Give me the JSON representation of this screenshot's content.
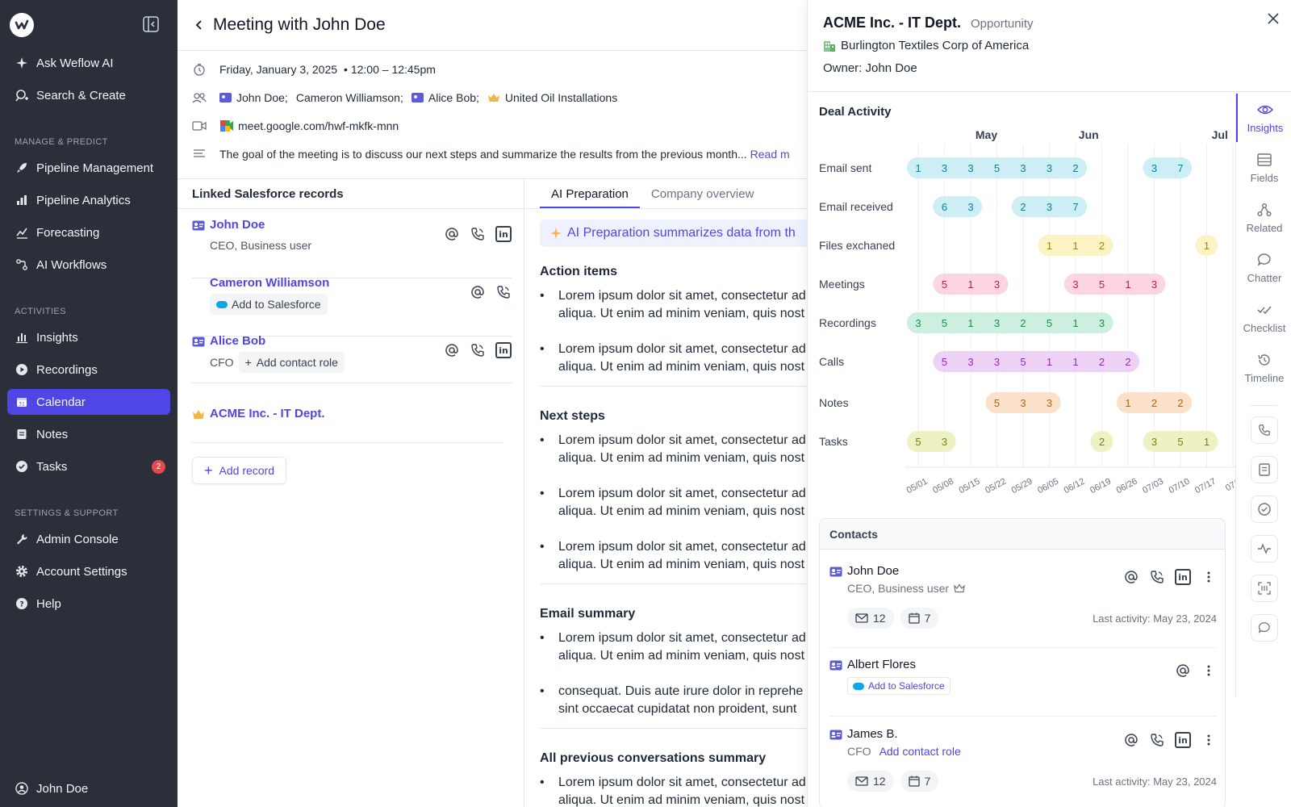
{
  "sidebar": {
    "top": [
      {
        "label": "Ask Weflow AI",
        "icon": "sparkle-icon"
      },
      {
        "label": "Search & Create",
        "icon": "search-plus-icon"
      }
    ],
    "sections": [
      {
        "title": "MANAGE & PREDICT",
        "items": [
          {
            "label": "Pipeline Management",
            "icon": "rocket-icon"
          },
          {
            "label": "Pipeline Analytics",
            "icon": "bar-chart-icon"
          },
          {
            "label": "Forecasting",
            "icon": "forecast-icon"
          },
          {
            "label": "AI Workflows",
            "icon": "workflow-icon"
          }
        ]
      },
      {
        "title": "ACTIVITIES",
        "items": [
          {
            "label": "Insights",
            "icon": "insights-icon"
          },
          {
            "label": "Recordings",
            "icon": "play-icon"
          },
          {
            "label": "Calendar",
            "icon": "calendar-icon"
          },
          {
            "label": "Notes",
            "icon": "note-icon"
          },
          {
            "label": "Tasks",
            "icon": "check-circle-icon",
            "badge": "2"
          }
        ]
      },
      {
        "title": "SETTINGS & SUPPORT",
        "items": [
          {
            "label": "Admin Console",
            "icon": "wrench-icon"
          },
          {
            "label": "Account Settings",
            "icon": "gear-icon"
          },
          {
            "label": "Help",
            "icon": "help-icon"
          }
        ]
      }
    ],
    "active": "Calendar",
    "user": "John Doe"
  },
  "meeting": {
    "title": "Meeting with John Doe",
    "date": "Friday, January 3, 2025",
    "time": "• 12:00 – 12:45pm",
    "attendees": [
      "John Doe;",
      "Cameron Williamson;",
      "Alice Bob;",
      "United Oil Installations"
    ],
    "meet_link": "meet.google.com/hwf-mkfk-mnn",
    "description": "The goal of the meeting is to discuss our next steps and summarize the results from the previous month...",
    "read_more": "Read m"
  },
  "linked": {
    "title": "Linked Salesforce records",
    "records": [
      {
        "name": "John Doe",
        "sub": "CEO, Business user"
      },
      {
        "name": "Cameron Williamson",
        "add_label": "Add to Salesforce"
      },
      {
        "name": "Alice Bob",
        "role": "CFO",
        "add_role": "Add contact role"
      },
      {
        "name": "ACME Inc. - IT Dept."
      }
    ],
    "add_record": "Add record"
  },
  "ai_panel": {
    "tabs": [
      "AI Preparation",
      "Company overview"
    ],
    "banner": "AI Preparation summarizes data from th",
    "sections": [
      {
        "title": "Action items",
        "bullets": [
          [
            "Lorem ipsum dolor sit amet, consectetur ad",
            "aliqua. Ut enim ad minim veniam, quis nost"
          ],
          [
            "Lorem ipsum dolor sit amet, consectetur ad",
            "aliqua. Ut enim ad minim veniam, quis nost"
          ]
        ]
      },
      {
        "title": "Next steps",
        "bullets": [
          [
            "Lorem ipsum dolor sit amet, consectetur ad",
            "aliqua. Ut enim ad minim veniam, quis nost"
          ],
          [
            "Lorem ipsum dolor sit amet, consectetur ad",
            "aliqua. Ut enim ad minim veniam, quis nost"
          ],
          [
            "Lorem ipsum dolor sit amet, consectetur ad",
            "aliqua. Ut enim ad minim veniam, quis nost"
          ]
        ]
      },
      {
        "title": "Email summary",
        "bullets": [
          [
            "Lorem ipsum dolor sit amet, consectetur ad",
            "aliqua. Ut enim ad minim veniam, quis nost"
          ],
          [
            "consequat. Duis aute irure dolor in reprehe",
            "sint occaecat cupidatat non proident, sunt"
          ]
        ]
      },
      {
        "title": "All previous conversations summary",
        "bullets": [
          [
            "Lorem ipsum dolor sit amet, consectetur ad",
            "aliqua. Ut enim ad minim veniam, quis nost"
          ]
        ]
      }
    ]
  },
  "panel": {
    "title": "ACME Inc. - IT Dept.",
    "kind": "Opportunity",
    "company": "Burlington Textiles Corp of America",
    "owner": "Owner: John Doe",
    "activity_title": "Deal Activity",
    "rail": [
      "Insights",
      "Fields",
      "Related",
      "Chatter",
      "Checklist",
      "Timeline"
    ]
  },
  "chart_data": {
    "type": "timeline-bubbles",
    "title": "Deal Activity",
    "months": [
      "May",
      "Jun",
      "Jul"
    ],
    "weeks": [
      "05/01",
      "05/08",
      "05/15",
      "05/22",
      "05/29",
      "06/05",
      "06/12",
      "06/19",
      "06/26",
      "07/03",
      "07/10",
      "07/17",
      "07/"
    ],
    "series": [
      {
        "name": "Email sent",
        "color": "#cdeef4",
        "text": "#0e7f96",
        "groups": [
          {
            "start": 0,
            "values": [
              1,
              3,
              3,
              5,
              3,
              3,
              2
            ]
          },
          {
            "start": 9,
            "values": [
              3,
              7
            ]
          }
        ]
      },
      {
        "name": "Email received",
        "color": "#cdeef4",
        "text": "#0e7f96",
        "groups": [
          {
            "start": 1,
            "values": [
              6,
              3
            ]
          },
          {
            "start": 4,
            "values": [
              2,
              3,
              7
            ]
          }
        ]
      },
      {
        "name": "Files exchaned",
        "color": "#fbf3c4",
        "text": "#a08310",
        "groups": [
          {
            "start": 5,
            "values": [
              1,
              1,
              2
            ]
          },
          {
            "start": 11,
            "values": [
              1
            ]
          }
        ]
      },
      {
        "name": "Meetings",
        "color": "#fbd5df",
        "text": "#be1e4d",
        "groups": [
          {
            "start": 1,
            "values": [
              5,
              1,
              3
            ]
          },
          {
            "start": 6,
            "values": [
              3,
              5,
              1,
              3
            ]
          }
        ]
      },
      {
        "name": "Recordings",
        "color": "#ccefdf",
        "text": "#1a8a5c",
        "groups": [
          {
            "start": 0,
            "values": [
              3,
              5,
              1,
              3,
              2,
              5,
              1,
              3
            ]
          }
        ]
      },
      {
        "name": "Calls",
        "color": "#ecd3f6",
        "text": "#8e2bb4",
        "groups": [
          {
            "start": 1,
            "values": [
              5,
              3,
              3,
              5,
              1,
              1,
              2,
              2
            ]
          }
        ]
      },
      {
        "name": "Notes",
        "color": "#fbe1c9",
        "text": "#b3620f",
        "groups": [
          {
            "start": 3,
            "values": [
              5,
              3,
              3
            ]
          },
          {
            "start": 8,
            "values": [
              1,
              2,
              2
            ]
          }
        ]
      },
      {
        "name": "Tasks",
        "color": "#eef1c2",
        "text": "#7a7f12",
        "groups": [
          {
            "start": 0,
            "values": [
              5,
              3
            ]
          },
          {
            "start": 7,
            "values": [
              2
            ]
          },
          {
            "start": 9,
            "values": [
              3,
              5,
              1
            ]
          }
        ]
      }
    ]
  },
  "contacts": {
    "title": "Contacts",
    "items": [
      {
        "name": "John Doe",
        "sub": "CEO, Business user",
        "emails": "12",
        "meetings": "7",
        "last": "Last activity: May 23, 2024"
      },
      {
        "name": "Albert Flores",
        "add_label": "Add to Salesforce"
      },
      {
        "name": "James B.",
        "role": "CFO",
        "add_role": "Add contact role",
        "emails": "12",
        "meetings": "7",
        "last": "Last activity: May 23, 2024"
      }
    ]
  }
}
